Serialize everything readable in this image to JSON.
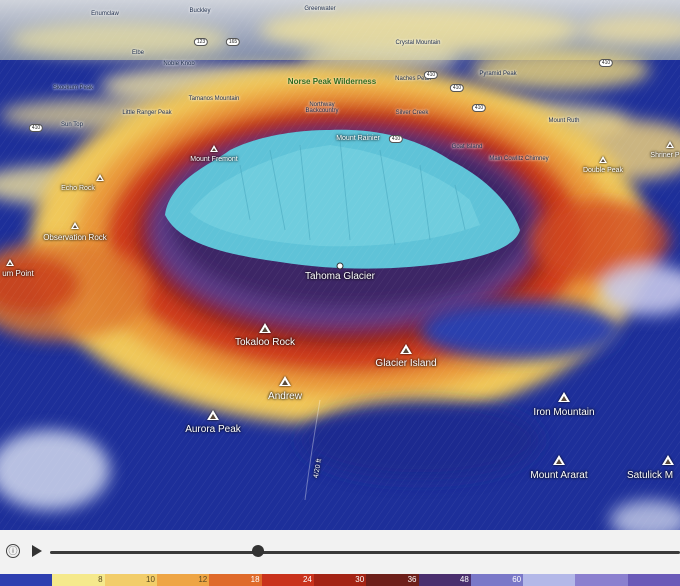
{
  "map": {
    "peaks": [
      {
        "name": "Tokaloo Rock"
      },
      {
        "name": "Glacier Island"
      },
      {
        "name": "Andrew"
      },
      {
        "name": "Aurora Peak"
      },
      {
        "name": "Iron Mountain"
      },
      {
        "name": "Mount Ararat"
      },
      {
        "name": "Satulick M"
      },
      {
        "name": "Observation Rock"
      },
      {
        "name": "Echo Rock"
      },
      {
        "name": "Mount Rainier"
      },
      {
        "name": "Double Peak"
      },
      {
        "name": "Mount Fremont"
      },
      {
        "name": "Shriner P"
      }
    ],
    "places": [
      {
        "name": "Tahoma Glacier"
      },
      {
        "name": "um Point"
      },
      {
        "name": "Norse Peak Wilderness"
      },
      {
        "name": "Northway Backcountry"
      },
      {
        "name": "Enumclaw"
      },
      {
        "name": "Greenwater"
      },
      {
        "name": "Buckley"
      },
      {
        "name": "Silver Creek"
      },
      {
        "name": "Crystal Mountain"
      },
      {
        "name": "Little Ranger Peak"
      },
      {
        "name": "Sun Top"
      },
      {
        "name": "Mount Ruth"
      },
      {
        "name": "Tamanos Mountain"
      },
      {
        "name": "Main Cowlitz Chimney"
      },
      {
        "name": "Goat Island"
      },
      {
        "name": "Naches Peak"
      },
      {
        "name": "Noble Knob"
      },
      {
        "name": "Elbe"
      },
      {
        "name": "Pyramid Peak"
      },
      {
        "name": "Skookum Peak"
      }
    ],
    "roads": [
      "410",
      "410",
      "410",
      "410",
      "410",
      "123",
      "410",
      "165"
    ],
    "road_label": "4/20 ft"
  },
  "controls": {
    "info_icon": "ⓘ",
    "progress": 0.33
  },
  "legend": {
    "colors": [
      "#2e3fb0",
      "#f5e98c",
      "#f2cd6a",
      "#eea545",
      "#df6a2a",
      "#c9321c",
      "#a32314",
      "#6d1f1a",
      "#4a2f6e",
      "#7a78c8",
      "#b3b8e8",
      "#8b80cf",
      "#6a5ab8"
    ],
    "values": [
      "",
      "8",
      "10",
      "12",
      "18",
      "24",
      "30",
      "36",
      "48",
      "60",
      "",
      "",
      ""
    ]
  }
}
